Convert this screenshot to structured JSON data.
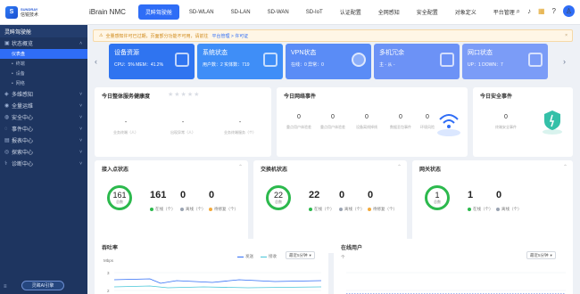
{
  "brand": {
    "en": "SUNDRAY",
    "cn": "信锐技术",
    "product": "iBrain NMC",
    "logo_letter": "S"
  },
  "nav": [
    {
      "label": "灵眸驾驶舱",
      "active": true
    },
    {
      "label": "SD-WLAN"
    },
    {
      "label": "SD-LAN"
    },
    {
      "label": "SD-WAN"
    },
    {
      "label": "SD-IoT"
    },
    {
      "label": "认证配置"
    },
    {
      "label": "全网感知"
    },
    {
      "label": "安全配置"
    },
    {
      "label": "对象定义"
    },
    {
      "label": "平台管理"
    }
  ],
  "top_icons": {
    "search": "⌕",
    "bell": "♪",
    "apps": "▦",
    "help": "?",
    "avatar": "♙"
  },
  "sidebar": {
    "title": "灵眸驾驶舱",
    "groups": [
      {
        "label": "状态概览",
        "icon": "▣",
        "expanded": true
      },
      {
        "label": "多维感知",
        "icon": "◈"
      },
      {
        "label": "全量运维",
        "icon": "◉"
      },
      {
        "label": "安全中心",
        "icon": "◍"
      },
      {
        "label": "事件中心",
        "icon": "◌"
      },
      {
        "label": "报表中心",
        "icon": "▤"
      },
      {
        "label": "探索中心",
        "icon": "◎"
      },
      {
        "label": "诊断中心",
        "icon": "⚕"
      }
    ],
    "subs": [
      {
        "label": "仪表盘",
        "active": true
      },
      {
        "label": "终端"
      },
      {
        "label": "设备"
      },
      {
        "label": "网络"
      }
    ],
    "ai_button": "灵眸AI引擎",
    "collapse_icon": "≡"
  },
  "notice": {
    "text": "全量感知许可已过期，页面部分功能不可用，请前往",
    "link": "平台管理 > 许可证",
    "close": "×"
  },
  "stat_cards": [
    {
      "title": "设备资源",
      "sub": "CPU：5%   MEM：41.2%",
      "color": "#2f74f0"
    },
    {
      "title": "系统状态",
      "sub": "用户数：2   实体数：719",
      "color": "#3f8ef7"
    },
    {
      "title": "VPN状态",
      "sub": "在线：0   异常：0",
      "color": "#5a8cf6"
    },
    {
      "title": "多机冗余",
      "sub": "主   -   从   -",
      "color": "#6c92f6"
    },
    {
      "title": "网口状态",
      "sub": "UP：1   DOWN：7",
      "color": "#7b9cf7"
    }
  ],
  "arrows": {
    "left": "‹",
    "right": "›"
  },
  "health": {
    "title": "今日整体服务健康度",
    "stars": "★★★★★",
    "items": [
      {
        "value": "-",
        "label": "业务终端（人）"
      },
      {
        "value": "-",
        "label": "出现异常（人）"
      },
      {
        "value": "-",
        "label": "业务终端服务（个）"
      }
    ]
  },
  "net_events": {
    "title": "今日网络事件",
    "items": [
      {
        "value": "0",
        "label": "重点用户体验差"
      },
      {
        "value": "0",
        "label": "重点用户体验差"
      },
      {
        "value": "0",
        "label": "设备离线掉线"
      },
      {
        "value": "0",
        "label": "数据丢包事件"
      },
      {
        "value": "0",
        "label": "环境风险"
      }
    ]
  },
  "sec_events": {
    "title": "今日安全事件",
    "value": "0",
    "label": "终端安全事件"
  },
  "ap_status": {
    "title": "接入点状态",
    "ring_value": "161",
    "ring_unit": "总数",
    "online": "161",
    "offline": "0",
    "pending": "0",
    "legend": [
      "在线（个）",
      "离线（个）",
      "待修复（个）"
    ]
  },
  "switch_status": {
    "title": "交换机状态",
    "ring_value": "22",
    "ring_unit": "总数",
    "online": "22",
    "offline": "0",
    "pending": "0",
    "legend": [
      "在线（个）",
      "离线（个）",
      "待修复（个）"
    ]
  },
  "gw_status": {
    "title": "网关状态",
    "ring_value": "1",
    "ring_unit": "总数",
    "online": "1",
    "offline": "0",
    "legend": [
      "在线（个）",
      "离线（个）"
    ]
  },
  "throughput": {
    "title": "吞吐率",
    "legend_up": "发送",
    "legend_down": "接收",
    "select": "最近5分钟",
    "unit": "Mbps",
    "y_ticks": [
      "3",
      "2"
    ]
  },
  "online_users": {
    "title": "在线用户",
    "select": "最近5分钟",
    "unit": "个"
  },
  "colors": {
    "accent": "#2f6df6",
    "online": "#2cb94d",
    "offline": "#9aa3b2",
    "pending": "#f2a93b",
    "sidebar": "#1e3560"
  }
}
